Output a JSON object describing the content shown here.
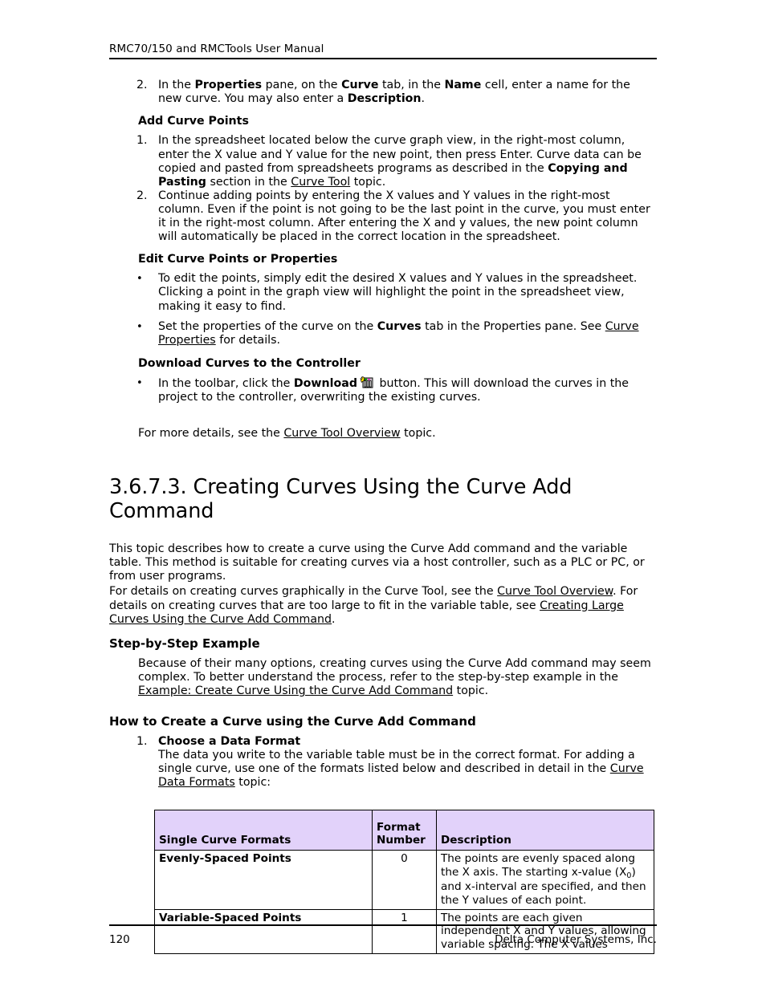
{
  "header": {
    "running_title": "RMC70/150 and RMCTools User Manual"
  },
  "footer": {
    "page_number": "120",
    "company": "Delta Computer Systems, Inc."
  },
  "theme": {
    "table_header_bg": "#E2D2FA",
    "text": "#000000",
    "rule": "#000000"
  },
  "step2": {
    "marker": "2.",
    "part1": "In the ",
    "bold1": "Properties",
    "part2": " pane, on the ",
    "bold2": "Curve",
    "part3": " tab, in the ",
    "bold3": "Name",
    "part4": " cell, enter a name for the new curve. You may also enter a ",
    "bold4": "Description",
    "part5": "."
  },
  "add_curve_points": {
    "heading": "Add Curve Points",
    "items": [
      {
        "marker": "1.",
        "part1": "In the spreadsheet located below the curve graph view, in the right-most column, enter the X value and Y value for the new point, then press Enter. Curve data can be copied and pasted from spreadsheets programs as described in the ",
        "bold1": "Copying and Pasting",
        "part2": " section in the ",
        "link1": "Curve Tool",
        "part3": " topic."
      },
      {
        "marker": "2.",
        "part1": "Continue adding points by entering the X values and Y values in the right-most column. Even if the point is not going to be the last point in the curve, you must enter it in the right-most column. After entering the X and y values, the new point column will automatically be placed in the correct location in the spreadsheet."
      }
    ]
  },
  "edit_curve": {
    "heading": "Edit Curve Points or Properties",
    "items": [
      {
        "marker": "•",
        "part1": "To edit the points, simply edit the desired X values and Y values in the spreadsheet. Clicking a point in the graph view will highlight the point in the spreadsheet view, making it easy to find."
      },
      {
        "marker": "•",
        "part1": "Set the properties of the curve on the ",
        "bold1": "Curves",
        "part2": " tab in the Properties pane. See ",
        "link1": "Curve Properties",
        "part3": " for details."
      }
    ]
  },
  "download_curves": {
    "heading": "Download Curves to the Controller",
    "marker": "•",
    "part1": "In the toolbar, click the ",
    "bold1": "Download",
    "icon_name": "download-curves-icon",
    "part2": " button. This will download the curves in the project to the controller, overwriting the existing curves."
  },
  "more_details": {
    "part1": "For more details, see the ",
    "link1": "Curve Tool Overview",
    "part2": " topic."
  },
  "section": {
    "title": "3.6.7.3. Creating Curves Using the Curve Add Command",
    "intro1": "This topic describes how to create a curve using the Curve Add command and the variable table. This method is suitable for creating curves via a host controller, such as a PLC or PC, or from user programs.",
    "intro2_part1": "For details on creating curves graphically in the Curve Tool, see the ",
    "intro2_link1": "Curve Tool Overview",
    "intro2_part2": ". For details on creating curves that are too large to fit in the variable table, see ",
    "intro2_link2": "Creating Large Curves Using the Curve Add Command",
    "intro2_part3": "."
  },
  "step_by_step": {
    "heading": "Step-by-Step Example",
    "part1": "Because of their many options, creating curves using the Curve Add command may seem complex. To better understand the process, refer to the step-by-step example in the ",
    "link1": "Example: Create Curve Using the Curve Add Command",
    "part2": " topic."
  },
  "how_to": {
    "heading": "How to Create a Curve using the Curve Add Command",
    "step1": {
      "marker": "1.",
      "bold_title": "Choose a Data Format",
      "part1": "The data you write to the variable table must be in the correct format. For adding a single curve, use one of the formats listed below and described in detail in the ",
      "link1": "Curve Data Formats",
      "part2": " topic:"
    }
  },
  "format_table": {
    "headers": {
      "col_name": "Single Curve Formats",
      "col_num_line1": "Format",
      "col_num_line2": "Number",
      "col_desc": "Description"
    },
    "rows": [
      {
        "name": "Evenly-Spaced Points",
        "number": "0",
        "desc_part1": "The points are evenly spaced along the X axis. The starting x-value (X",
        "desc_sub": "0",
        "desc_part2": ") and x-interval are specified, and then the Y values of each point."
      },
      {
        "name": "Variable-Spaced Points",
        "number": "1",
        "desc_part1": "The points are each given independent X and Y values, allowing variable spacing. The X values",
        "desc_sub": "",
        "desc_part2": ""
      }
    ]
  }
}
